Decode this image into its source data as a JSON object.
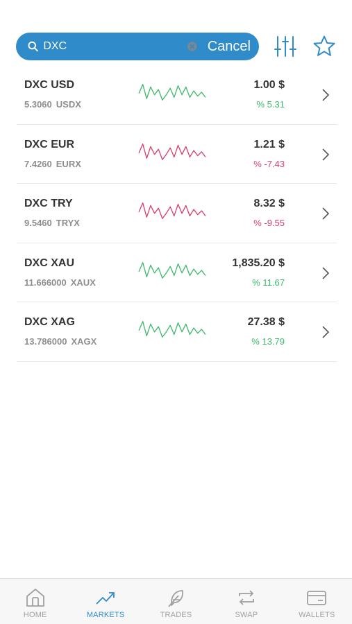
{
  "search": {
    "value": "DXC",
    "cancel_label": "Cancel"
  },
  "colors": {
    "accent": "#2f8bc9",
    "positive": "#3dba6c",
    "negative": "#d93f6b"
  },
  "markets": [
    {
      "pair": "DXC USD",
      "volume": "5.3060",
      "code": "USDX",
      "price": "1.00 $",
      "change": "% 5.31",
      "trend": "up"
    },
    {
      "pair": "DXC EUR",
      "volume": "7.4260",
      "code": "EURX",
      "price": "1.21 $",
      "change": "% -7.43",
      "trend": "down"
    },
    {
      "pair": "DXC TRY",
      "volume": "9.5460",
      "code": "TRYX",
      "price": "8.32 $",
      "change": "% -9.55",
      "trend": "down"
    },
    {
      "pair": "DXC XAU",
      "volume": "11.666000",
      "code": "XAUX",
      "price": "1,835.20 $",
      "change": "% 11.67",
      "trend": "up"
    },
    {
      "pair": "DXC XAG",
      "volume": "13.786000",
      "code": "XAGX",
      "price": "27.38 $",
      "change": "% 13.79",
      "trend": "up"
    }
  ],
  "tabs": [
    {
      "label": "HOME",
      "icon": "home-icon"
    },
    {
      "label": "MARKETS",
      "icon": "trending-up-icon",
      "active": true
    },
    {
      "label": "TRADES",
      "icon": "feather-icon"
    },
    {
      "label": "SWAP",
      "icon": "swap-icon"
    },
    {
      "label": "WALLETS",
      "icon": "wallet-icon"
    }
  ]
}
